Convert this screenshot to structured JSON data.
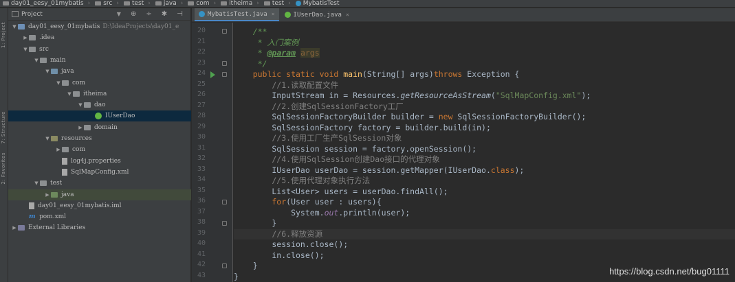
{
  "breadcrumbs": [
    "day01_eesy_01mybatis",
    "src",
    "test",
    "java",
    "com",
    "itheima",
    "test",
    "MybatisTest"
  ],
  "tool_strip": {
    "labels": [
      "1: Project",
      "7: Structure",
      "2: Favorites"
    ]
  },
  "project": {
    "title": "Project",
    "tree": [
      {
        "label": "day01_eesy_01mybatis",
        "path": "D:\\IdeaProjects\\day01_e",
        "icon": "module-folder-icon",
        "arrow": "▼"
      },
      {
        "label": ".idea",
        "icon": "folder-icon",
        "arrow": "▶"
      },
      {
        "label": "src",
        "icon": "folder-icon",
        "arrow": "▼"
      },
      {
        "label": "main",
        "icon": "folder-icon",
        "arrow": "▼"
      },
      {
        "label": "java",
        "icon": "source-folder-icon",
        "arrow": "▼"
      },
      {
        "label": "com",
        "icon": "package-icon",
        "arrow": "▼"
      },
      {
        "label": "itheima",
        "icon": "package-icon",
        "arrow": "▼"
      },
      {
        "label": "dao",
        "icon": "package-icon",
        "arrow": "▼"
      },
      {
        "label": "IUserDao",
        "icon": "interface-icon",
        "arrow": ""
      },
      {
        "label": "domain",
        "icon": "package-icon",
        "arrow": "▶"
      },
      {
        "label": "resources",
        "icon": "resources-folder-icon",
        "arrow": "▼"
      },
      {
        "label": "com",
        "icon": "package-icon",
        "arrow": "▶"
      },
      {
        "label": "log4j.properties",
        "icon": "properties-file-icon",
        "arrow": ""
      },
      {
        "label": "SqlMapConfig.xml",
        "icon": "xml-file-icon",
        "arrow": ""
      },
      {
        "label": "test",
        "icon": "test-folder-icon",
        "arrow": "▼"
      },
      {
        "label": "java",
        "icon": "test-source-folder-icon",
        "arrow": "▶"
      },
      {
        "label": "day01_eesy_01mybatis.iml",
        "icon": "iml-file-icon",
        "arrow": ""
      },
      {
        "label": "pom.xml",
        "icon": "maven-icon",
        "arrow": ""
      },
      {
        "label": "External Libraries",
        "icon": "library-icon",
        "arrow": "▶"
      }
    ]
  },
  "tabs": [
    {
      "label": "MybatisTest.java",
      "active": true,
      "color": "#3592c4"
    },
    {
      "label": "IUserDao.java",
      "active": false,
      "color": "#62b543"
    }
  ],
  "gutter": {
    "line_numbers": [
      "20",
      "21",
      "22",
      "23",
      "24",
      "25",
      "26",
      "27",
      "28",
      "29",
      "30",
      "31",
      "32",
      "33",
      "34",
      "35",
      "36",
      "37",
      "38",
      "39",
      "40",
      "41",
      "42",
      "43"
    ]
  },
  "code_lines": [
    {
      "n": "20",
      "segs": [
        [
          "doc",
          "    /**"
        ]
      ]
    },
    {
      "n": "21",
      "segs": [
        [
          "doc",
          "     * "
        ],
        [
          "doc cjk",
          "入门案例"
        ]
      ]
    },
    {
      "n": "22",
      "segs": [
        [
          "doc",
          "     * "
        ],
        [
          "doctag",
          "@param"
        ],
        [
          "doc",
          " "
        ],
        [
          "docparam",
          "args"
        ]
      ]
    },
    {
      "n": "23",
      "segs": [
        [
          "doc",
          "     */"
        ]
      ]
    },
    {
      "n": "24",
      "segs": [
        [
          "kw",
          "    public static void "
        ],
        [
          "fn",
          "main"
        ],
        [
          "",
          "(String[] args)"
        ],
        [
          "kw",
          "throws "
        ],
        [
          "",
          "Exception {"
        ]
      ]
    },
    {
      "n": "25",
      "segs": [
        [
          "cm",
          "        //1."
        ],
        [
          "cm cjk",
          "读取配置文件"
        ]
      ]
    },
    {
      "n": "26",
      "segs": [
        [
          "",
          "        InputStream in = Resources."
        ],
        [
          "it",
          "getResourceAsStream"
        ],
        [
          "",
          "("
        ],
        [
          "str",
          "\"SqlMapConfig.xml\""
        ],
        [
          "",
          ");"
        ]
      ]
    },
    {
      "n": "27",
      "segs": [
        [
          "cm",
          "        //2."
        ],
        [
          "cm cjk",
          "创建"
        ],
        [
          "cm",
          "SqlSessionFactory"
        ],
        [
          "cm cjk",
          "工厂"
        ]
      ]
    },
    {
      "n": "28",
      "segs": [
        [
          "",
          "        SqlSessionFactoryBuilder builder = "
        ],
        [
          "kw",
          "new "
        ],
        [
          "",
          "SqlSessionFactoryBuilder();"
        ]
      ]
    },
    {
      "n": "29",
      "segs": [
        [
          "",
          "        SqlSessionFactory factory = builder.build(in);"
        ]
      ]
    },
    {
      "n": "30",
      "segs": [
        [
          "cm",
          "        //3."
        ],
        [
          "cm cjk",
          "使用工厂生产"
        ],
        [
          "cm",
          "SqlSession"
        ],
        [
          "cm cjk",
          "对象"
        ]
      ]
    },
    {
      "n": "31",
      "segs": [
        [
          "",
          "        SqlSession session = factory.openSession();"
        ]
      ]
    },
    {
      "n": "32",
      "segs": [
        [
          "cm",
          "        //4."
        ],
        [
          "cm cjk",
          "使用"
        ],
        [
          "cm",
          "SqlSession"
        ],
        [
          "cm cjk",
          "创建"
        ],
        [
          "cm",
          "Dao"
        ],
        [
          "cm cjk",
          "接口的代理对象"
        ]
      ]
    },
    {
      "n": "33",
      "segs": [
        [
          "",
          "        IUserDao userDao = session.getMapper(IUserDao."
        ],
        [
          "kw",
          "class"
        ],
        [
          "",
          ");"
        ]
      ]
    },
    {
      "n": "34",
      "segs": [
        [
          "cm",
          "        //5."
        ],
        [
          "cm cjk",
          "使用代理对象执行方法"
        ]
      ]
    },
    {
      "n": "35",
      "segs": [
        [
          "",
          "        List<User> users = userDao.findAll();"
        ]
      ]
    },
    {
      "n": "36",
      "segs": [
        [
          "kw",
          "        for"
        ],
        [
          "",
          "(User user : users){"
        ]
      ]
    },
    {
      "n": "37",
      "segs": [
        [
          "",
          "            System."
        ],
        [
          "field",
          "out"
        ],
        [
          "",
          ".println(user);"
        ]
      ]
    },
    {
      "n": "38",
      "segs": [
        [
          "",
          "        }"
        ]
      ]
    },
    {
      "n": "39",
      "segs": [
        [
          "cm",
          "        //6."
        ],
        [
          "cm cjk",
          "释放资源"
        ]
      ]
    },
    {
      "n": "40",
      "segs": [
        [
          "",
          "        session.close();"
        ]
      ]
    },
    {
      "n": "41",
      "segs": [
        [
          "",
          "        in.close();"
        ]
      ]
    },
    {
      "n": "42",
      "segs": [
        [
          "",
          "    }"
        ]
      ]
    },
    {
      "n": "43",
      "segs": [
        [
          "",
          "}"
        ]
      ]
    }
  ],
  "watermark": "https://blog.csdn.net/bug01111"
}
